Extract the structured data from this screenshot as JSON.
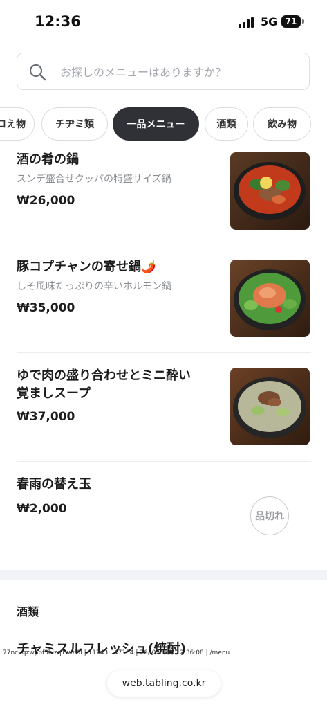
{
  "status_bar": {
    "time": "12:36",
    "network": "5G",
    "battery": "71"
  },
  "search": {
    "placeholder": "お探しのメニューはありますか？"
  },
  "tabs": [
    {
      "label": "ロえ物"
    },
    {
      "label": "チヂミ類"
    },
    {
      "label": "一品メニュー",
      "active": true
    },
    {
      "label": "酒類"
    },
    {
      "label": "飲み物"
    }
  ],
  "menu_items": [
    {
      "name": "酒の肴の鍋",
      "description": "スンデ盛合せクッパの特盛サイズ鍋",
      "price": "₩26,000",
      "photo": "spicy-hotpot-photo"
    },
    {
      "name": "豚コプチャンの寄せ鍋🌶️",
      "description": "しそ風味たっぷりの辛いホルモン鍋",
      "price": "₩35,000",
      "photo": "intestine-hotpot-photo"
    },
    {
      "name": "ゆで肉の盛り合わせとミニ酔い覚ましスープ",
      "name_lines": [
        "ゆで肉の盛り合わせとミニ酔い",
        "覚ましスープ"
      ],
      "price": "₩37,000",
      "photo": "boiled-meat-platter-photo"
    },
    {
      "name": "春雨の替え玉",
      "price": "₩2,000",
      "badge": "品切れ"
    }
  ],
  "section": {
    "title": "酒類"
  },
  "next_item": {
    "name": "チャミスルフレッシュ(焼酎)"
  },
  "debug_text": "77ncuqzwppf3hizq1w0f6l | 11243 | 47154 | 26/ 02/ 16/ 12:36:08 | /menu",
  "url_bar": {
    "domain": "web.tabling.co.kr"
  },
  "colors": {
    "active_tab": "#2f3136",
    "border": "#dcdfe3",
    "muted_text": "#8a8d92",
    "section_bg": "#f1f3f6"
  }
}
